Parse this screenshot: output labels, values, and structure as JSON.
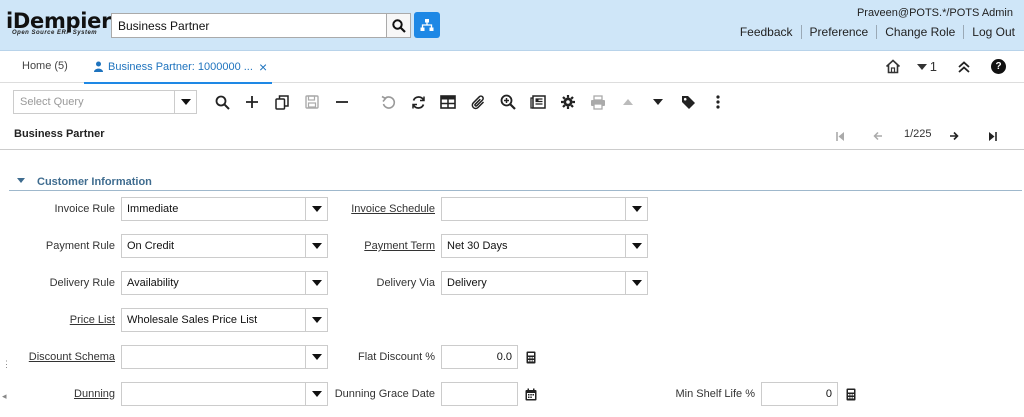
{
  "header": {
    "logo_title": "iDempiere",
    "logo_subtitle": "Open Source ERP System",
    "search_value": "Business Partner",
    "user": "Praveen@POTS.*/POTS Admin",
    "links": [
      "Feedback",
      "Preference",
      "Change Role",
      "Log Out"
    ]
  },
  "tabs": {
    "home": "Home (5)",
    "active": "Business Partner: 1000000 ...",
    "close": "×",
    "window_count": "1",
    "help": "?"
  },
  "toolbar": {
    "query_placeholder": "Select Query",
    "icons": [
      "search-icon",
      "new-icon",
      "copy-icon",
      "save-icon",
      "delete-icon",
      "undo-icon",
      "refresh-icon",
      "grid-toggle-icon",
      "attachment-icon",
      "zoom-across-icon",
      "report-icon",
      "process-icon",
      "print-icon",
      "up-arrow-icon",
      "more-dropdown-icon",
      "label-icon",
      "kebab-menu-icon"
    ]
  },
  "record": {
    "title": "Business Partner",
    "counter": "1/225"
  },
  "section": {
    "title": "Customer Information"
  },
  "form": {
    "invoice_rule": {
      "label": "Invoice Rule",
      "value": "Immediate"
    },
    "invoice_schedule": {
      "label": "Invoice Schedule",
      "value": ""
    },
    "payment_rule": {
      "label": "Payment Rule",
      "value": "On Credit"
    },
    "payment_term": {
      "label": "Payment Term",
      "value": "Net 30 Days"
    },
    "delivery_rule": {
      "label": "Delivery Rule",
      "value": "Availability"
    },
    "delivery_via": {
      "label": "Delivery Via",
      "value": "Delivery"
    },
    "price_list": {
      "label": "Price List",
      "value": "Wholesale Sales Price List"
    },
    "discount_schema": {
      "label": "Discount Schema",
      "value": ""
    },
    "flat_discount": {
      "label": "Flat Discount %",
      "value": "0.0"
    },
    "dunning": {
      "label": "Dunning",
      "value": ""
    },
    "dunning_grace_date": {
      "label": "Dunning Grace Date",
      "value": ""
    },
    "min_shelf_life": {
      "label": "Min Shelf Life %",
      "value": "0"
    }
  },
  "colors": {
    "header_bg": "#cfe6f8",
    "accent": "#1e88e5",
    "section_title": "#3f6c8f"
  }
}
